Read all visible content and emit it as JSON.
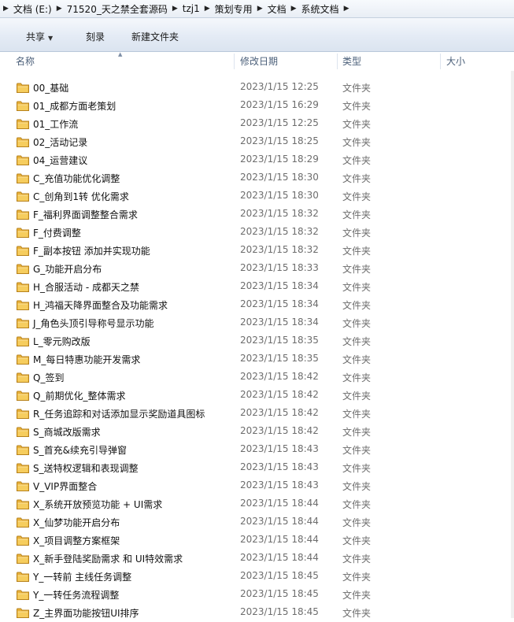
{
  "address_bar": {
    "crumbs": [
      "文档 (E:)",
      "71520_天之禁全套源码",
      "tzj1",
      "策划专用",
      "文档",
      "系统文档"
    ]
  },
  "toolbar": {
    "share_label": "共享",
    "burn_label": "刻录",
    "new_folder_label": "新建文件夹"
  },
  "columns": {
    "name": "名称",
    "date": "修改日期",
    "type": "类型",
    "size": "大小"
  },
  "files": [
    {
      "name": "00_基础",
      "date": "2023/1/15 12:25",
      "type": "文件夹"
    },
    {
      "name": "01_成都方面老策划",
      "date": "2023/1/15 16:29",
      "type": "文件夹"
    },
    {
      "name": "01_工作流",
      "date": "2023/1/15 12:25",
      "type": "文件夹"
    },
    {
      "name": "02_活动记录",
      "date": "2023/1/15 18:25",
      "type": "文件夹"
    },
    {
      "name": "04_运营建议",
      "date": "2023/1/15 18:29",
      "type": "文件夹"
    },
    {
      "name": "C_充值功能优化调整",
      "date": "2023/1/15 18:30",
      "type": "文件夹"
    },
    {
      "name": "C_创角到1转 优化需求",
      "date": "2023/1/15 18:30",
      "type": "文件夹"
    },
    {
      "name": "F_福利界面调整整合需求",
      "date": "2023/1/15 18:32",
      "type": "文件夹"
    },
    {
      "name": "F_付费调整",
      "date": "2023/1/15 18:32",
      "type": "文件夹"
    },
    {
      "name": "F_副本按钮 添加并实现功能",
      "date": "2023/1/15 18:32",
      "type": "文件夹"
    },
    {
      "name": "G_功能开启分布",
      "date": "2023/1/15 18:33",
      "type": "文件夹"
    },
    {
      "name": "H_合服活动 - 成都天之禁",
      "date": "2023/1/15 18:34",
      "type": "文件夹"
    },
    {
      "name": "H_鸿福天降界面整合及功能需求",
      "date": "2023/1/15 18:34",
      "type": "文件夹"
    },
    {
      "name": "J_角色头顶引导称号显示功能",
      "date": "2023/1/15 18:34",
      "type": "文件夹"
    },
    {
      "name": "L_零元购改版",
      "date": "2023/1/15 18:35",
      "type": "文件夹"
    },
    {
      "name": "M_每日特惠功能开发需求",
      "date": "2023/1/15 18:35",
      "type": "文件夹"
    },
    {
      "name": "Q_签到",
      "date": "2023/1/15 18:42",
      "type": "文件夹"
    },
    {
      "name": "Q_前期优化_整体需求",
      "date": "2023/1/15 18:42",
      "type": "文件夹"
    },
    {
      "name": "R_任务追踪和对话添加显示奖励道具图标",
      "date": "2023/1/15 18:42",
      "type": "文件夹"
    },
    {
      "name": "S_商城改版需求",
      "date": "2023/1/15 18:42",
      "type": "文件夹"
    },
    {
      "name": "S_首充&续充引导弹窗",
      "date": "2023/1/15 18:43",
      "type": "文件夹"
    },
    {
      "name": "S_送特权逻辑和表现调整",
      "date": "2023/1/15 18:43",
      "type": "文件夹"
    },
    {
      "name": "V_VIP界面整合",
      "date": "2023/1/15 18:43",
      "type": "文件夹"
    },
    {
      "name": "X_系统开放预览功能 + UI需求",
      "date": "2023/1/15 18:44",
      "type": "文件夹"
    },
    {
      "name": "X_仙梦功能开启分布",
      "date": "2023/1/15 18:44",
      "type": "文件夹"
    },
    {
      "name": "X_项目调整方案框架",
      "date": "2023/1/15 18:44",
      "type": "文件夹"
    },
    {
      "name": "X_新手登陆奖励需求 和 UI特效需求",
      "date": "2023/1/15 18:44",
      "type": "文件夹"
    },
    {
      "name": "Y_一转前 主线任务调整",
      "date": "2023/1/15 18:45",
      "type": "文件夹"
    },
    {
      "name": "Y_一转任务流程调整",
      "date": "2023/1/15 18:45",
      "type": "文件夹"
    },
    {
      "name": "Z_主界面功能按钮UI排序",
      "date": "2023/1/15 18:45",
      "type": "文件夹"
    }
  ]
}
